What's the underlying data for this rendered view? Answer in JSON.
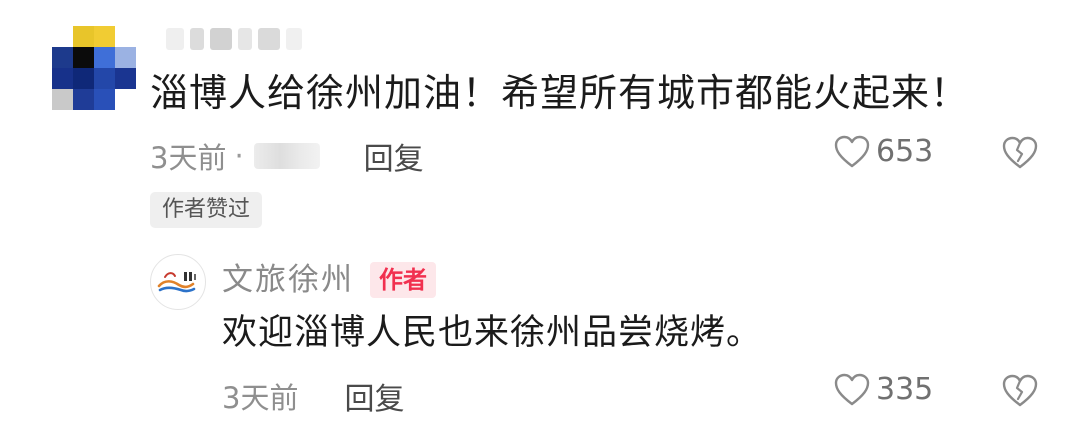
{
  "comment": {
    "avatar_colors": [
      [
        "#ffffff",
        "#e8c52a",
        "#f1cc33",
        "#ffffff"
      ],
      [
        "#1d3a8c",
        "#0b0b0b",
        "#3f6fd8",
        "#9bb2e3"
      ],
      [
        "#17318a",
        "#0f2878",
        "#2347a9",
        "#1a3591"
      ],
      [
        "#c9c9c9",
        "#1f3c97",
        "#2950b8",
        "#ffffff"
      ]
    ],
    "text": "淄博人给徐州加油！希望所有城市都能火起来！",
    "time": "3天前",
    "separator": "·",
    "reply_label": "回复",
    "like_count": "653",
    "author_liked_label": "作者赞过"
  },
  "reply": {
    "username": "文旅徐州",
    "author_badge": "作者",
    "text": "欢迎淄博人民也来徐州品尝烧烤。",
    "time": "3天前",
    "reply_label": "回复",
    "like_count": "335"
  },
  "colors": {
    "badge_text": "#f1304f",
    "badge_bg": "#fde7ea",
    "meta_gray": "#8f8f8f"
  },
  "icons": {
    "like": "heart-outline-icon",
    "dislike": "broken-heart-outline-icon"
  }
}
